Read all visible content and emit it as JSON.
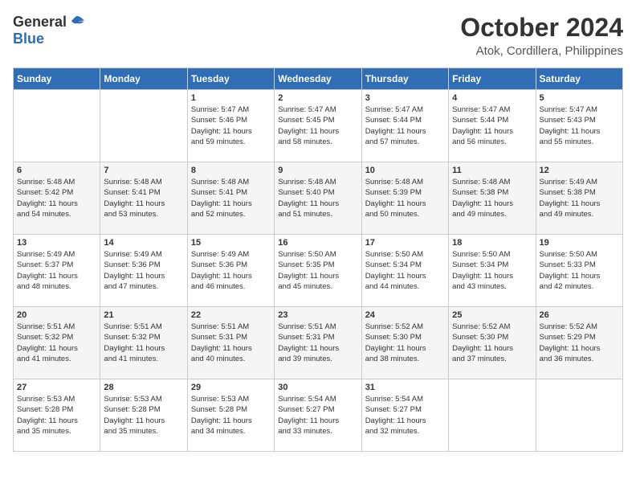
{
  "header": {
    "logo_general": "General",
    "logo_blue": "Blue",
    "month": "October 2024",
    "location": "Atok, Cordillera, Philippines"
  },
  "weekdays": [
    "Sunday",
    "Monday",
    "Tuesday",
    "Wednesday",
    "Thursday",
    "Friday",
    "Saturday"
  ],
  "weeks": [
    [
      {
        "day": "",
        "info": ""
      },
      {
        "day": "",
        "info": ""
      },
      {
        "day": "1",
        "info": "Sunrise: 5:47 AM\nSunset: 5:46 PM\nDaylight: 11 hours\nand 59 minutes."
      },
      {
        "day": "2",
        "info": "Sunrise: 5:47 AM\nSunset: 5:45 PM\nDaylight: 11 hours\nand 58 minutes."
      },
      {
        "day": "3",
        "info": "Sunrise: 5:47 AM\nSunset: 5:44 PM\nDaylight: 11 hours\nand 57 minutes."
      },
      {
        "day": "4",
        "info": "Sunrise: 5:47 AM\nSunset: 5:44 PM\nDaylight: 11 hours\nand 56 minutes."
      },
      {
        "day": "5",
        "info": "Sunrise: 5:47 AM\nSunset: 5:43 PM\nDaylight: 11 hours\nand 55 minutes."
      }
    ],
    [
      {
        "day": "6",
        "info": "Sunrise: 5:48 AM\nSunset: 5:42 PM\nDaylight: 11 hours\nand 54 minutes."
      },
      {
        "day": "7",
        "info": "Sunrise: 5:48 AM\nSunset: 5:41 PM\nDaylight: 11 hours\nand 53 minutes."
      },
      {
        "day": "8",
        "info": "Sunrise: 5:48 AM\nSunset: 5:41 PM\nDaylight: 11 hours\nand 52 minutes."
      },
      {
        "day": "9",
        "info": "Sunrise: 5:48 AM\nSunset: 5:40 PM\nDaylight: 11 hours\nand 51 minutes."
      },
      {
        "day": "10",
        "info": "Sunrise: 5:48 AM\nSunset: 5:39 PM\nDaylight: 11 hours\nand 50 minutes."
      },
      {
        "day": "11",
        "info": "Sunrise: 5:48 AM\nSunset: 5:38 PM\nDaylight: 11 hours\nand 49 minutes."
      },
      {
        "day": "12",
        "info": "Sunrise: 5:49 AM\nSunset: 5:38 PM\nDaylight: 11 hours\nand 49 minutes."
      }
    ],
    [
      {
        "day": "13",
        "info": "Sunrise: 5:49 AM\nSunset: 5:37 PM\nDaylight: 11 hours\nand 48 minutes."
      },
      {
        "day": "14",
        "info": "Sunrise: 5:49 AM\nSunset: 5:36 PM\nDaylight: 11 hours\nand 47 minutes."
      },
      {
        "day": "15",
        "info": "Sunrise: 5:49 AM\nSunset: 5:36 PM\nDaylight: 11 hours\nand 46 minutes."
      },
      {
        "day": "16",
        "info": "Sunrise: 5:50 AM\nSunset: 5:35 PM\nDaylight: 11 hours\nand 45 minutes."
      },
      {
        "day": "17",
        "info": "Sunrise: 5:50 AM\nSunset: 5:34 PM\nDaylight: 11 hours\nand 44 minutes."
      },
      {
        "day": "18",
        "info": "Sunrise: 5:50 AM\nSunset: 5:34 PM\nDaylight: 11 hours\nand 43 minutes."
      },
      {
        "day": "19",
        "info": "Sunrise: 5:50 AM\nSunset: 5:33 PM\nDaylight: 11 hours\nand 42 minutes."
      }
    ],
    [
      {
        "day": "20",
        "info": "Sunrise: 5:51 AM\nSunset: 5:32 PM\nDaylight: 11 hours\nand 41 minutes."
      },
      {
        "day": "21",
        "info": "Sunrise: 5:51 AM\nSunset: 5:32 PM\nDaylight: 11 hours\nand 41 minutes."
      },
      {
        "day": "22",
        "info": "Sunrise: 5:51 AM\nSunset: 5:31 PM\nDaylight: 11 hours\nand 40 minutes."
      },
      {
        "day": "23",
        "info": "Sunrise: 5:51 AM\nSunset: 5:31 PM\nDaylight: 11 hours\nand 39 minutes."
      },
      {
        "day": "24",
        "info": "Sunrise: 5:52 AM\nSunset: 5:30 PM\nDaylight: 11 hours\nand 38 minutes."
      },
      {
        "day": "25",
        "info": "Sunrise: 5:52 AM\nSunset: 5:30 PM\nDaylight: 11 hours\nand 37 minutes."
      },
      {
        "day": "26",
        "info": "Sunrise: 5:52 AM\nSunset: 5:29 PM\nDaylight: 11 hours\nand 36 minutes."
      }
    ],
    [
      {
        "day": "27",
        "info": "Sunrise: 5:53 AM\nSunset: 5:28 PM\nDaylight: 11 hours\nand 35 minutes."
      },
      {
        "day": "28",
        "info": "Sunrise: 5:53 AM\nSunset: 5:28 PM\nDaylight: 11 hours\nand 35 minutes."
      },
      {
        "day": "29",
        "info": "Sunrise: 5:53 AM\nSunset: 5:28 PM\nDaylight: 11 hours\nand 34 minutes."
      },
      {
        "day": "30",
        "info": "Sunrise: 5:54 AM\nSunset: 5:27 PM\nDaylight: 11 hours\nand 33 minutes."
      },
      {
        "day": "31",
        "info": "Sunrise: 5:54 AM\nSunset: 5:27 PM\nDaylight: 11 hours\nand 32 minutes."
      },
      {
        "day": "",
        "info": ""
      },
      {
        "day": "",
        "info": ""
      }
    ]
  ]
}
